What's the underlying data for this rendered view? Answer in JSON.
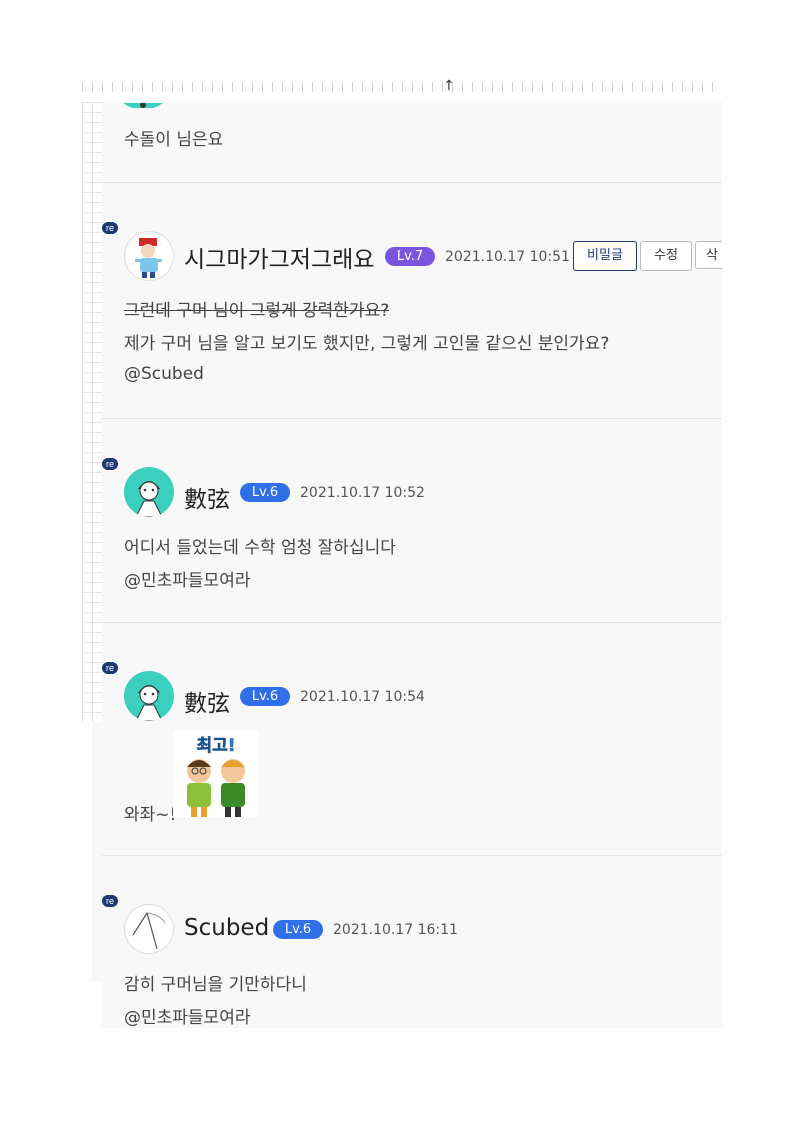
{
  "comments": [
    {
      "text": "수돌이 님은요"
    },
    {
      "re": "re",
      "nick": "시그마가그저그래요",
      "level": "Lv.7",
      "time": "2021.10.17 10:51",
      "buttons": [
        "비밀글",
        "수정",
        "삭"
      ],
      "line1": "그런데 구머 님이 그렇게 강력한가요?",
      "line2": "제가 구머 님을 알고 보기도 했지만, 그렇게 고인물 같으신 분인가요?",
      "mention": "@Scubed"
    },
    {
      "re": "re",
      "nick": "數弦",
      "level": "Lv.6",
      "time": "2021.10.17 10:52",
      "line1": "어디서 들었는데 수학 엄청 잘하십니다",
      "mention": "@민초파들모여라"
    },
    {
      "re": "re",
      "nick": "數弦",
      "level": "Lv.6",
      "time": "2021.10.17 10:54",
      "line1": "와좌~!",
      "sticker_text": "최고!"
    },
    {
      "re": "re",
      "nick": "Scubed",
      "level": "Lv.6",
      "time": "2021.10.17 16:11",
      "line1": "감히 구머님을 기만하다니",
      "mention": "@민초파들모여라"
    }
  ],
  "colors": {
    "lv7": "#7b55e0",
    "lv6": "#2f6fe8",
    "re_badge": "#1d3a74",
    "panel": "#f8f8f8"
  }
}
